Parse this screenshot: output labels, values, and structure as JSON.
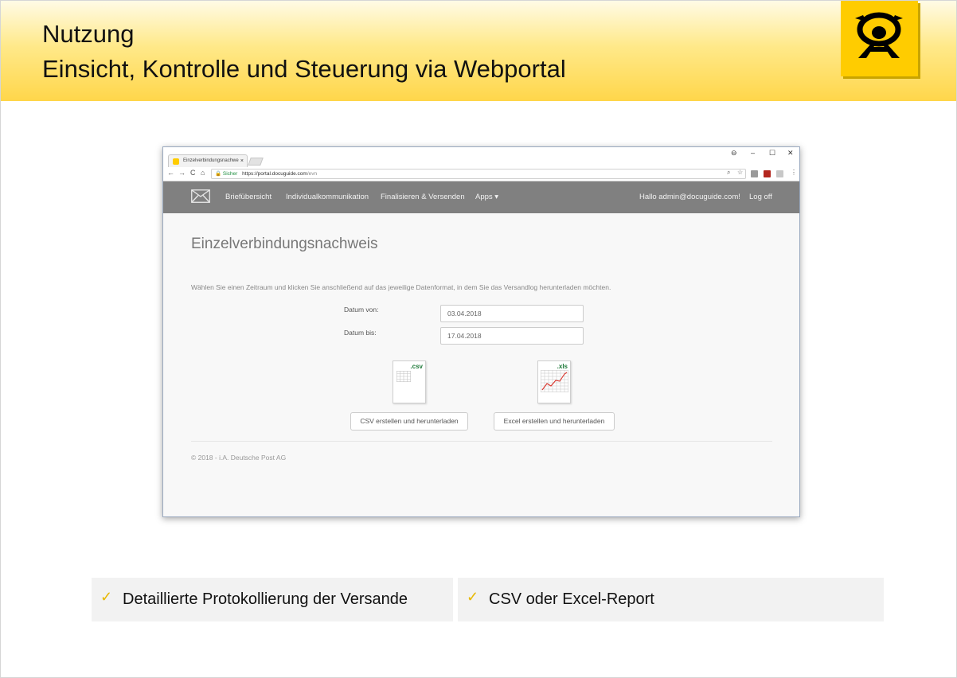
{
  "slide": {
    "title_line1": "Nutzung",
    "title_line2": "Einsicht, Kontrolle und Steuerung via Webportal",
    "logo_icon": "deutsche-post-horn-icon",
    "brand_color": "#ffcc00"
  },
  "browser": {
    "tab_title": "Einzelverbindungsnachwe",
    "tab_close": "×",
    "window_controls": {
      "profile": "⊖",
      "minimize": "–",
      "maximize": "☐",
      "close": "✕"
    },
    "nav": {
      "back": "←",
      "forward": "→",
      "reload": "C",
      "home": "⌂"
    },
    "address": {
      "lock": "🔒",
      "secure_label": "Sicher",
      "url_main": "https://portal.docuguide.com",
      "url_path": "/evn"
    },
    "menu_dots": "⋮"
  },
  "app": {
    "nav_items": [
      "Briefübersicht",
      "Individualkommunikation",
      "Finalisieren & Versenden",
      "Apps ▾"
    ],
    "greeting": "Hallo admin@docuguide.com!",
    "logoff": "Log off",
    "page_title": "Einzelverbindungsnachweis",
    "instructions": "Wählen Sie einen Zeitraum und klicken Sie anschließend auf das jeweilige Datenformat, in dem Sie das Versandlog herunterladen möchten.",
    "date_from_label": "Datum von:",
    "date_from_value": "03.04.2018",
    "date_to_label": "Datum bis:",
    "date_to_value": "17.04.2018",
    "csv_ext": ".csv",
    "xls_ext": ".xls",
    "csv_button": "CSV erstellen und herunterladen",
    "excel_button": "Excel erstellen und herunterladen",
    "footer": "© 2018 - i.A. Deutsche Post AG"
  },
  "bullets": {
    "check_glyph": "✓",
    "item1": "Detaillierte Protokollierung der Versande",
    "item2": "CSV oder Excel-Report",
    "check_color": "#e8b800"
  }
}
